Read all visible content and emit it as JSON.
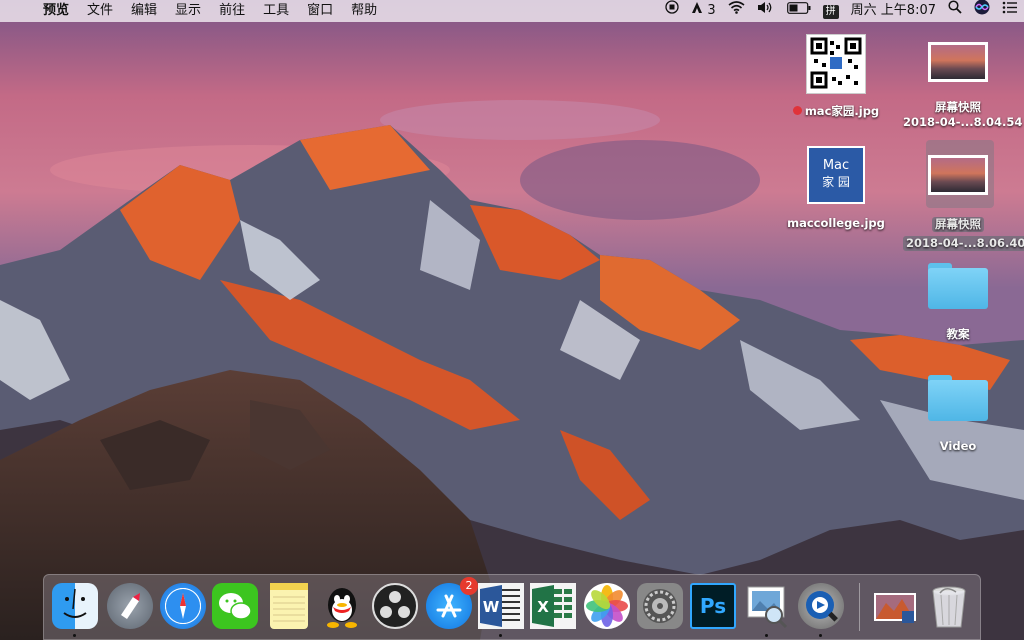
{
  "menubar": {
    "apple": "",
    "menus": [
      "预览",
      "文件",
      "编辑",
      "显示",
      "前往",
      "工具",
      "窗口",
      "帮助"
    ],
    "tray": {
      "adobe_count": "3",
      "input_method": "拼",
      "clock": "周六 上午8:07"
    }
  },
  "desktop": {
    "icons": [
      {
        "label": "mac家园.jpg",
        "tag_color": "#e0333a"
      },
      {
        "label_line1": "屏幕快照",
        "label_line2": "2018-04-...8.04.54"
      },
      {
        "label": "maccollege.jpg",
        "thumb_text_1": "Mac",
        "thumb_text_2": "家 园"
      },
      {
        "label_line1": "屏幕快照",
        "label_line2": "2018-04-...8.06.40"
      },
      {
        "label": "教案"
      },
      {
        "label": "Video"
      }
    ]
  },
  "dock": {
    "apps": [
      {
        "name": "Finder",
        "icon": "finder-icon",
        "running": true
      },
      {
        "name": "Launchpad",
        "icon": "launchpad-icon",
        "running": false
      },
      {
        "name": "Safari",
        "icon": "safari-icon",
        "running": false
      },
      {
        "name": "WeChat",
        "icon": "wechat-icon",
        "running": false
      },
      {
        "name": "Notes",
        "icon": "notes-icon",
        "running": false
      },
      {
        "name": "QQ",
        "icon": "qq-icon",
        "running": false
      },
      {
        "name": "OBS",
        "icon": "obs-icon",
        "running": false
      },
      {
        "name": "App Store",
        "icon": "app-store-icon",
        "running": false,
        "badge": "2"
      },
      {
        "name": "Word",
        "icon": "word-icon",
        "running": true
      },
      {
        "name": "Excel",
        "icon": "excel-icon",
        "running": false
      },
      {
        "name": "Photos",
        "icon": "photos-icon",
        "running": false
      },
      {
        "name": "System Preferences",
        "icon": "system-preferences-icon",
        "running": false
      },
      {
        "name": "Photoshop",
        "icon": "photoshop-icon",
        "running": false,
        "text": "Ps"
      },
      {
        "name": "Preview",
        "icon": "preview-icon",
        "running": true
      },
      {
        "name": "QuickTime",
        "icon": "quicktime-icon",
        "running": true
      }
    ],
    "others": [
      {
        "name": "Screenshot document",
        "icon": "document-thumbnail-icon"
      },
      {
        "name": "Trash",
        "icon": "trash-icon"
      }
    ]
  }
}
